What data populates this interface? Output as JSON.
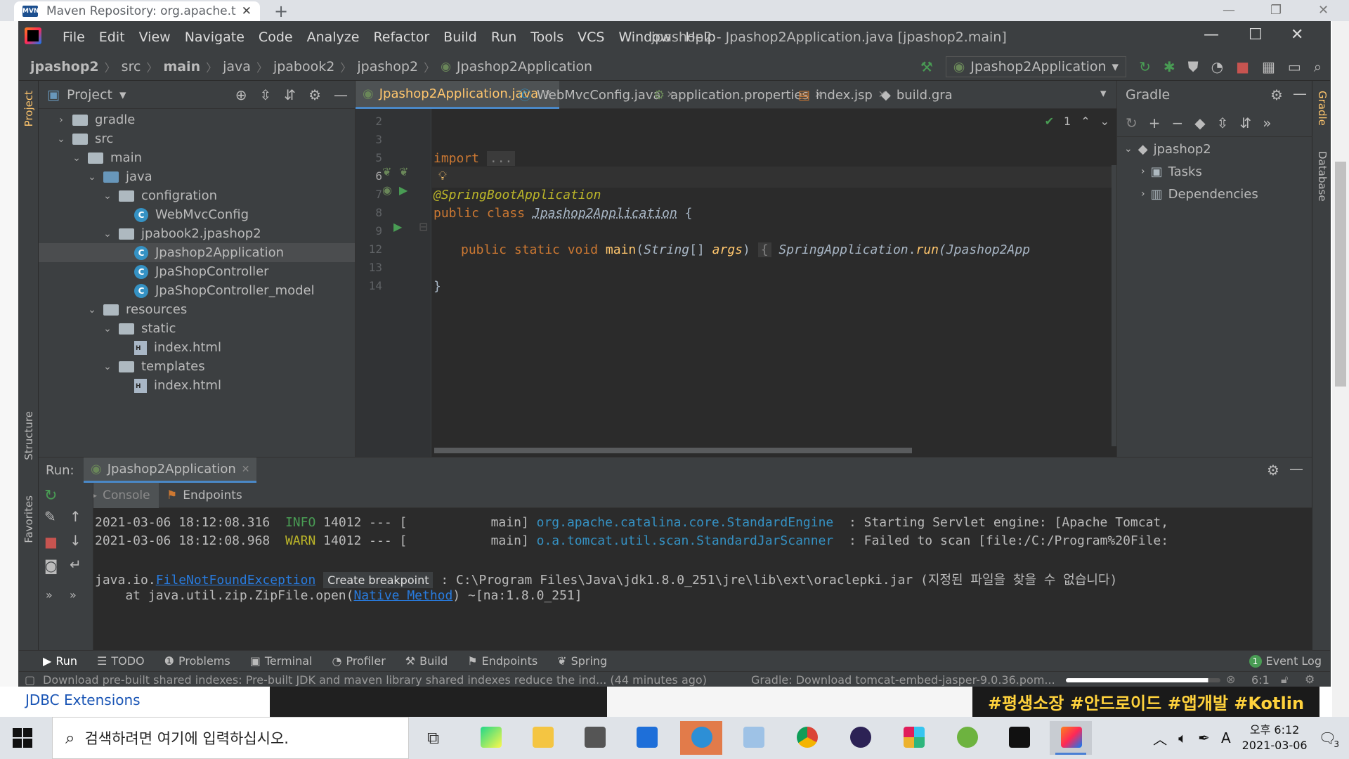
{
  "browser": {
    "tab_title": "Maven Repository: org.apache.t",
    "tab_favicon": "MVN",
    "page_link": "JDBC Extensions",
    "banner_text": "#평생소장 #안드로이드 #앱개발 #Kotlin"
  },
  "ide": {
    "menu": [
      "File",
      "Edit",
      "View",
      "Navigate",
      "Code",
      "Analyze",
      "Refactor",
      "Build",
      "Run",
      "Tools",
      "VCS",
      "Window",
      "Help"
    ],
    "window_title": "jpashop2 - Jpashop2Application.java [jpashop2.main]",
    "breadcrumbs": [
      "jpashop2",
      "src",
      "main",
      "java",
      "jpabook2",
      "jpashop2",
      "Jpashop2Application"
    ],
    "run_config": "Jpashop2Application",
    "left_strip": [
      "Project",
      "Structure",
      "Favorites"
    ],
    "right_strip": [
      "Gradle",
      "Database"
    ]
  },
  "project": {
    "title": "Project",
    "tree": [
      {
        "label": "gradle",
        "depth": 1,
        "type": "folder",
        "expanded": false
      },
      {
        "label": "src",
        "depth": 1,
        "type": "folder",
        "expanded": true
      },
      {
        "label": "main",
        "depth": 2,
        "type": "folder",
        "expanded": true
      },
      {
        "label": "java",
        "depth": 3,
        "type": "folder-blue",
        "expanded": true
      },
      {
        "label": "configration",
        "depth": 4,
        "type": "folder",
        "expanded": true
      },
      {
        "label": "WebMvcConfig",
        "depth": 5,
        "type": "class"
      },
      {
        "label": "jpabook2.jpashop2",
        "depth": 4,
        "type": "folder",
        "expanded": true
      },
      {
        "label": "Jpashop2Application",
        "depth": 5,
        "type": "class",
        "selected": true
      },
      {
        "label": "JpaShopController",
        "depth": 5,
        "type": "class"
      },
      {
        "label": "JpaShopController_model",
        "depth": 5,
        "type": "class"
      },
      {
        "label": "resources",
        "depth": 3,
        "type": "folder",
        "expanded": true
      },
      {
        "label": "static",
        "depth": 4,
        "type": "folder",
        "expanded": true
      },
      {
        "label": "index.html",
        "depth": 5,
        "type": "html"
      },
      {
        "label": "templates",
        "depth": 4,
        "type": "folder",
        "expanded": true
      },
      {
        "label": "index.html",
        "depth": 5,
        "type": "html"
      }
    ]
  },
  "editor": {
    "tabs": [
      {
        "label": "Jpashop2Application.java",
        "active": true
      },
      {
        "label": "WebMvcConfig.java"
      },
      {
        "label": "application.properties"
      },
      {
        "label": "index.jsp"
      },
      {
        "label": "build.gra"
      }
    ],
    "inspections": "1",
    "line_numbers": [
      "2",
      "3",
      "5",
      "6",
      "7",
      "8",
      "9",
      "12",
      "13",
      "14"
    ],
    "code": {
      "import_kw": "import",
      "import_fold": "...",
      "annotation": "@SpringBootApplication",
      "class_decl": "public class",
      "class_name": "Jpashop2Application",
      "brace_open": "{",
      "main_kw": "public static void",
      "main_name": "main",
      "main_sig_1": "(",
      "main_type": "String",
      "main_sig_2": "[] ",
      "main_args": "args",
      "main_sig_3": ")",
      "fold_brace": "{",
      "spring_cls": "SpringApplication",
      "dot": ".",
      "run_m": "run",
      "run_arg": "(Jpashop2App",
      "brace_close": "}"
    }
  },
  "gradle": {
    "title": "Gradle",
    "root": "jpashop2",
    "children": [
      "Tasks",
      "Dependencies"
    ]
  },
  "run": {
    "label": "Run:",
    "tab": "Jpashop2Application",
    "subtabs": [
      "Console",
      "Endpoints"
    ],
    "log": [
      {
        "ts": "2021-03-06 18:12:08.316",
        "level": "INFO",
        "pid": "14012",
        "sep": "--- [",
        "thread": "main]",
        "logger": "org.apache.catalina.core.StandardEngine",
        "msg": ": Starting Servlet engine: [Apache Tomcat,"
      },
      {
        "ts": "2021-03-06 18:12:08.968",
        "level": "WARN",
        "pid": "14012",
        "sep": "--- [",
        "thread": "main]",
        "logger": "o.a.tomcat.util.scan.StandardJarScanner",
        "msg": ": Failed to scan [file:/C:/Program%20File:"
      }
    ],
    "exception": {
      "prefix": "java.io.",
      "link": "FileNotFoundException",
      "tooltip": "Create breakpoint",
      "msg": ": C:\\Program Files\\Java\\jdk1.8.0_251\\jre\\lib\\ext\\oraclepki.jar (지정된 파일을 찾을 수 없습니다)"
    },
    "trace": {
      "prefix": "    at java.util.zip.ZipFile.open(",
      "link": "Native Method",
      "suffix": ") ~[na:1.8.0_251]"
    }
  },
  "bottom_tools": [
    "Run",
    "TODO",
    "Problems",
    "Terminal",
    "Profiler",
    "Build",
    "Endpoints",
    "Spring"
  ],
  "event_log": {
    "count": "1",
    "label": "Event Log"
  },
  "status": {
    "left": "Download pre-built shared indexes: Pre-built JDK and maven library shared indexes reduce the ind... (44 minutes ago)",
    "gradle_task": "Gradle: Download tomcat-embed-jasper-9.0.36.pom...",
    "progress": 0.92,
    "position": "6:1"
  },
  "taskbar": {
    "search_placeholder": "검색하려면 여기에 입력하십시오.",
    "time": "오후 6:12",
    "date": "2021-03-06",
    "ime": "A",
    "notifications": "3"
  },
  "colors": {
    "ide_bg": "#2b2b2b",
    "panel_bg": "#3c3f41",
    "keyword": "#cc7832",
    "annotation": "#bbb529",
    "method": "#ffc66d",
    "link": "#287bde"
  }
}
